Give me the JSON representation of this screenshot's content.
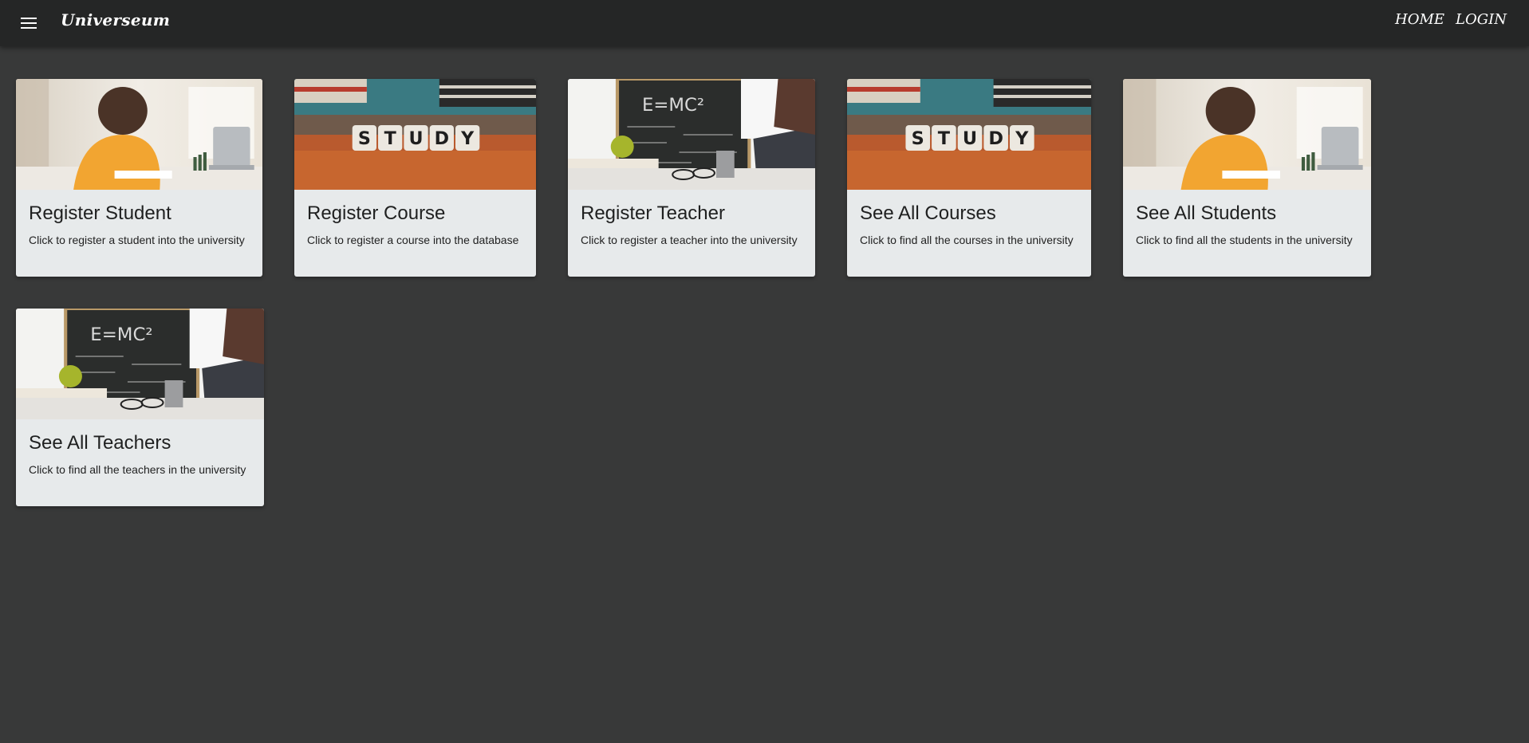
{
  "header": {
    "brand": "Universeum",
    "menu_icon": "menu-icon",
    "nav": [
      {
        "label": "HOME"
      },
      {
        "label": "LOGIN"
      }
    ]
  },
  "cards": [
    {
      "title": "Register Student",
      "description": "Click to register a student into the university",
      "image": "student-writing-image"
    },
    {
      "title": "Register Course",
      "description": "Click to register a course into the database",
      "image": "study-blocks-image"
    },
    {
      "title": "Register Teacher",
      "description": "Click to register a teacher into the university",
      "image": "chalkboard-teacher-image"
    },
    {
      "title": "See All Courses",
      "description": "Click to find all the courses in the university",
      "image": "study-blocks-image"
    },
    {
      "title": "See All Students",
      "description": "Click to find all the students in the university",
      "image": "student-writing-image"
    },
    {
      "title": "See All Teachers",
      "description": "Click to find all the teachers in the university",
      "image": "chalkboard-teacher-image"
    }
  ],
  "image_text": {
    "study_letters": [
      "S",
      "T",
      "U",
      "D",
      "Y"
    ],
    "chalk_formula": "E=MC²"
  },
  "colors": {
    "background": "#383939",
    "appbar": "#252626",
    "card": "#e7eaeb"
  }
}
